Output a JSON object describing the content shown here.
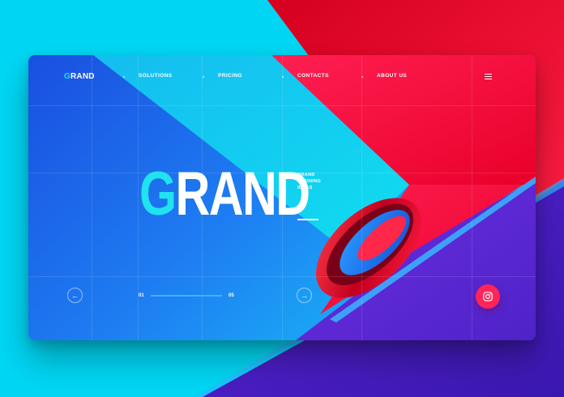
{
  "brand": {
    "logo_first": "G",
    "logo_rest": "RAND"
  },
  "nav": {
    "items": [
      {
        "label": "SOLUTIONS"
      },
      {
        "label": "PRICING"
      },
      {
        "label": "CONTACTS"
      },
      {
        "label": "ABOUT US"
      }
    ]
  },
  "hero": {
    "title_first": "G",
    "title_rest": "RAND",
    "tagline": [
      "BRAND",
      "DEFINING",
      "IDEAS"
    ]
  },
  "slider": {
    "current": "01",
    "total": "05",
    "progress": 1.0
  },
  "icons": {
    "menu": "hamburger-icon",
    "prev": "arrow-left-icon",
    "next": "arrow-right-icon",
    "social": "instagram-icon"
  },
  "colors": {
    "cyan": "#00d8f4",
    "blue": "#1a5be6",
    "red": "#ff1f4b",
    "purple": "#6a2ed8",
    "accent_pink": "#ff2459",
    "logo_accent": "#20e3ef"
  }
}
